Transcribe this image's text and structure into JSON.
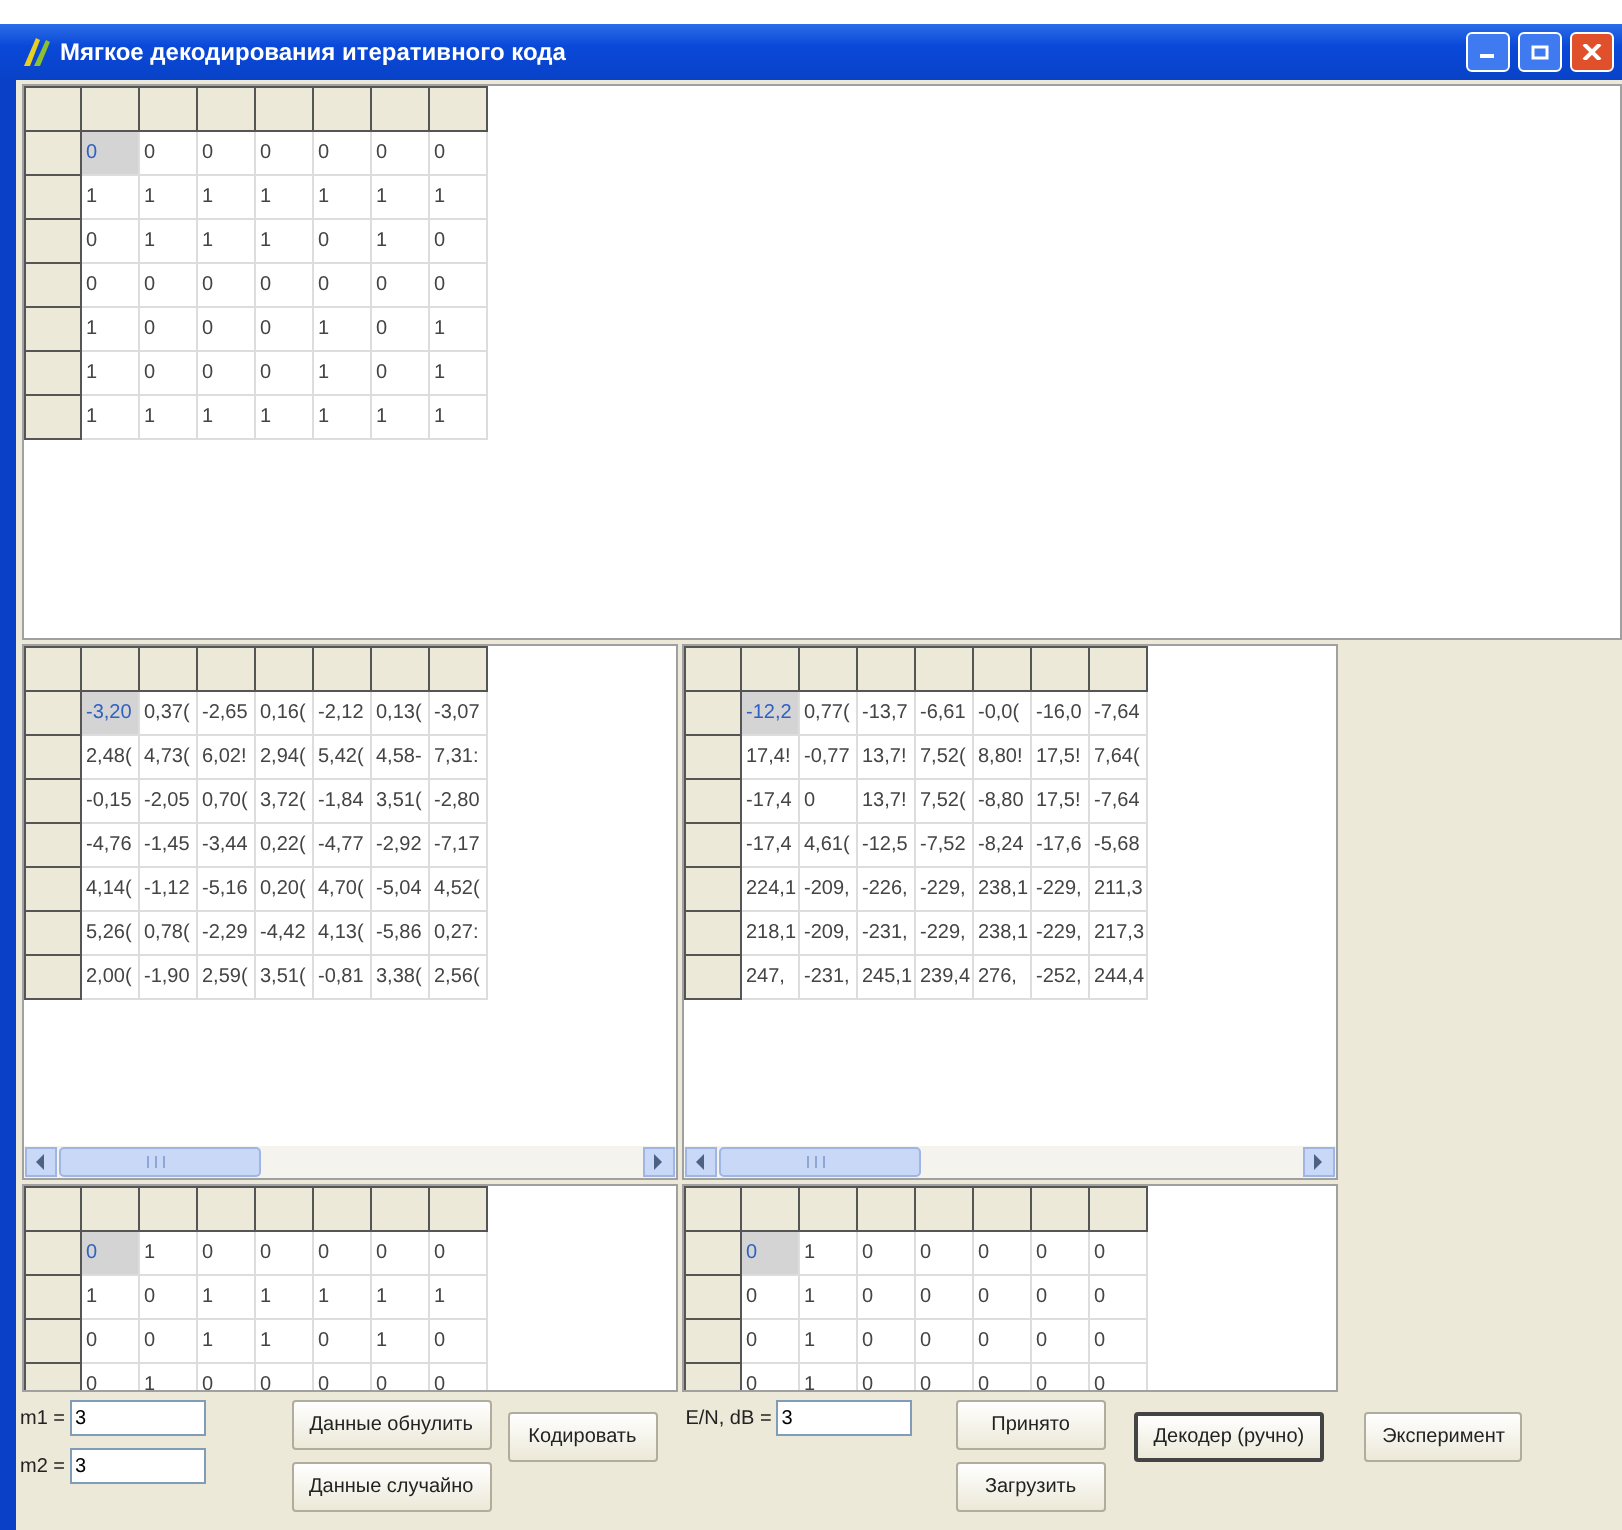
{
  "window": {
    "title": "Мягкое декодирования итеративного кода"
  },
  "top_grid": {
    "focus_first_cell": true,
    "rows": [
      [
        "0",
        "0",
        "0",
        "0",
        "0",
        "0",
        "0"
      ],
      [
        "1",
        "1",
        "1",
        "1",
        "1",
        "1",
        "1"
      ],
      [
        "0",
        "1",
        "1",
        "1",
        "0",
        "1",
        "0"
      ],
      [
        "0",
        "0",
        "0",
        "0",
        "0",
        "0",
        "0"
      ],
      [
        "1",
        "0",
        "0",
        "0",
        "1",
        "0",
        "1"
      ],
      [
        "1",
        "0",
        "0",
        "0",
        "1",
        "0",
        "1"
      ],
      [
        "1",
        "1",
        "1",
        "1",
        "1",
        "1",
        "1"
      ]
    ]
  },
  "middle_grids": [
    {
      "focus_first_cell": true,
      "rows": [
        [
          "-3,20",
          "0,37(",
          "-2,65",
          "0,16(",
          "-2,12",
          "0,13(",
          "-3,07"
        ],
        [
          "2,48(",
          "4,73(",
          "6,02!",
          "2,94(",
          "5,42(",
          "4,58-",
          "7,31:"
        ],
        [
          "-0,15",
          "-2,05",
          "0,70(",
          "3,72(",
          "-1,84",
          "3,51(",
          "-2,80"
        ],
        [
          "-4,76",
          "-1,45",
          "-3,44",
          "0,22(",
          "-4,77",
          "-2,92",
          "-7,17"
        ],
        [
          "4,14(",
          "-1,12",
          "-5,16",
          "0,20(",
          "4,70(",
          "-5,04",
          "4,52("
        ],
        [
          "5,26(",
          "0,78(",
          "-2,29",
          "-4,42",
          "4,13(",
          "-5,86",
          "0,27:"
        ],
        [
          "2,00(",
          "-1,90",
          "2,59(",
          "3,51(",
          "-0,81",
          "3,38(",
          "2,56("
        ]
      ]
    },
    {
      "focus_first_cell": true,
      "rows": [
        [
          "-12,2",
          "0,77(",
          "-13,7",
          "-6,61",
          "-0,0(",
          "-16,0",
          "-7,64"
        ],
        [
          "17,4!",
          "-0,77",
          "13,7!",
          "7,52(",
          "8,80!",
          "17,5!",
          "7,64("
        ],
        [
          "-17,4",
          "0",
          "13,7!",
          "7,52(",
          "-8,80",
          "17,5!",
          "-7,64"
        ],
        [
          "-17,4",
          "4,61(",
          "-12,5",
          "-7,52",
          "-8,24",
          "-17,6",
          "-5,68"
        ],
        [
          "224,1",
          "-209,",
          "-226,",
          "-229,",
          "238,1",
          "-229,",
          "211,3"
        ],
        [
          "218,1",
          "-209,",
          "-231,",
          "-229,",
          "238,1",
          "-229,",
          "217,3"
        ],
        [
          "247,",
          "-231,",
          "245,1",
          "239,4",
          "276,",
          "-252,",
          "244,4"
        ]
      ]
    }
  ],
  "bottom_grids": [
    {
      "focus_first_cell": true,
      "rows": [
        [
          "0",
          "1",
          "0",
          "0",
          "0",
          "0",
          "0"
        ],
        [
          "1",
          "0",
          "1",
          "1",
          "1",
          "1",
          "1"
        ],
        [
          "0",
          "0",
          "1",
          "1",
          "0",
          "1",
          "0"
        ],
        [
          "0",
          "1",
          "0",
          "0",
          "0",
          "0",
          "0"
        ]
      ]
    },
    {
      "focus_first_cell": true,
      "rows": [
        [
          "0",
          "1",
          "0",
          "0",
          "0",
          "0",
          "0"
        ],
        [
          "0",
          "1",
          "0",
          "0",
          "0",
          "0",
          "0"
        ],
        [
          "0",
          "1",
          "0",
          "0",
          "0",
          "0",
          "0"
        ],
        [
          "0",
          "1",
          "0",
          "0",
          "0",
          "0",
          "0"
        ]
      ]
    }
  ],
  "controls": [
    [
      {
        "kind": "field",
        "label": "m1 =",
        "value": "3"
      },
      {
        "kind": "field",
        "label": "m2 =",
        "value": "3"
      }
    ],
    [
      {
        "kind": "button",
        "label": "Данные обнулить",
        "default": false
      },
      {
        "kind": "button",
        "label": "Данные случайно",
        "default": false
      }
    ],
    [
      {
        "kind": "button",
        "label": "Кодировать",
        "default": false
      }
    ],
    [
      {
        "kind": "field",
        "label": "E/N, dB =",
        "value": "3"
      }
    ],
    [
      {
        "kind": "button",
        "label": "Принято",
        "default": false
      },
      {
        "kind": "button",
        "label": "Загрузить",
        "default": false
      }
    ],
    [
      {
        "kind": "button",
        "label": "Декодер (ручно)",
        "default": true
      }
    ],
    [
      {
        "kind": "button",
        "label": "Эксперимент",
        "default": false
      }
    ]
  ]
}
